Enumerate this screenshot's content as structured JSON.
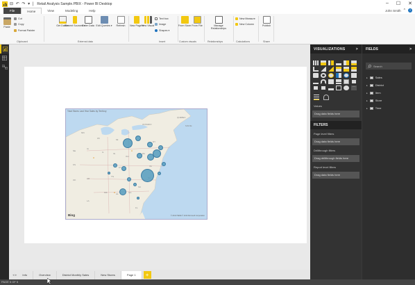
{
  "window": {
    "title": "Retail Analysis Sample.PBIX - Power BI Desktop",
    "quick_access": "⊟ ↶ ↷ ▾ |",
    "minimize": "–",
    "maximize": "☐",
    "close": "✕"
  },
  "tabs": [
    "File",
    "Home",
    "View",
    "Modeling",
    "Help"
  ],
  "user": {
    "name": "John Smith",
    "caret": "^",
    "help": "?"
  },
  "ribbon": {
    "clipboard": {
      "paste": "Paste",
      "cut": "Cut",
      "copy": "Copy",
      "format_painter": "Format Painter",
      "group": "Clipboard"
    },
    "external_data": {
      "get_data": "Get Data ▾",
      "recent_sources": "Recent Sources ▾",
      "enter_data": "Enter Data",
      "edit_queries": "Edit Queries ▾",
      "refresh": "Refresh",
      "group": "External data"
    },
    "insert": {
      "new_page": "New Page ▾",
      "new_visual": "New Visual",
      "text_box": "Text box",
      "image": "Image",
      "shapes": "Shapes ▾",
      "group": "Insert"
    },
    "custom_visuals": {
      "from_store": "From Store",
      "from_file": "From File",
      "group": "Custom visuals"
    },
    "relationships": {
      "manage": "Manage Relationships",
      "group": "Relationships"
    },
    "calculations": {
      "new_measure": "New Measure",
      "new_column": "New Column",
      "group": "Calculations"
    },
    "share": {
      "publish": "Publish",
      "group": "Share"
    }
  },
  "map": {
    "title": "Total Stores Last Year Sales by Territory",
    "provider": "Bing",
    "copyright": "© 2016 HERE © 2016 Microsoft Corporation",
    "labels": [
      "ONTARIO",
      "QUEBEC",
      "MAINE",
      "NH",
      "VT",
      "MA",
      "NY",
      "PA",
      "OH",
      "IN",
      "IL",
      "MI",
      "WI",
      "KY",
      "TN",
      "VA",
      "NC",
      "SC",
      "GA",
      "AL",
      "MS",
      "FL",
      "WV",
      "MD",
      "MO",
      "AR",
      "LA",
      "KS",
      "OK",
      "IA",
      "NE",
      "MN"
    ],
    "bubble_count": 17
  },
  "page_tabs": {
    "items": [
      "Info",
      "Overview",
      "District Monthly Sales",
      "New Stores",
      "Page 1"
    ],
    "active": "Page 1",
    "add": "+",
    "nav": "◂ ▸"
  },
  "status": "PAGE 5 OF 5",
  "visualizations": {
    "header": "VISUALIZATIONS",
    "arrow": ">",
    "values_label": "Values",
    "values_drop": "Drag data fields here",
    "filters_header": "FILTERS",
    "page_filters": "Page level filters",
    "page_drop": "Drag data fields here",
    "drill_filters": "Drillthrough filters",
    "drill_drop": "Drag drillthrough fields here",
    "report_filters": "Report level filters",
    "report_drop": "Drag data fields here"
  },
  "fields": {
    "header": "FIELDS",
    "arrow": ">",
    "search_placeholder": "Search",
    "tables": [
      "Sales",
      "District",
      "Item",
      "Store",
      "Time"
    ]
  },
  "colors": {
    "accent": "#f2c811",
    "bubble": "#549bbe",
    "pane": "#333333",
    "map_water": "#bdd9f0",
    "map_land": "#f0ede2"
  }
}
